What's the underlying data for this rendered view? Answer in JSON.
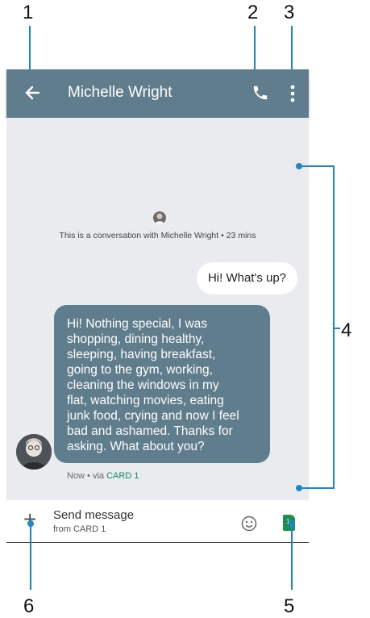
{
  "callouts": {
    "n1": "1",
    "n2": "2",
    "n3": "3",
    "n4": "4",
    "n5": "5",
    "n6": "6"
  },
  "appbar": {
    "title": "Michelle Wright",
    "back_icon": "arrow-back-icon",
    "phone_icon": "phone-icon",
    "menu_icon": "more-vert-icon"
  },
  "conversation": {
    "intro_text": "This is a conversation with Michelle Wright • 23 mins",
    "outgoing_message": "Hi! What's up?",
    "incoming_lines": [
      "Hi! Nothing special, I was",
      "shopping, dining healthy,",
      "sleeping,  having breakfast,",
      "going to the gym, working,",
      "cleaning the windows in my",
      "flat, watching movies, eating",
      "junk food, crying and now I feel",
      "bad and ashamed. Thanks for",
      "asking. What about you?"
    ],
    "meta_time": "Now • via ",
    "meta_sim": "CARD 1"
  },
  "composer": {
    "plus_label": "+",
    "placeholder": "Send message",
    "sim_sub": "from CARD 1",
    "emoji_icon": "emoji-icon",
    "sim_icon": "sim-card-icon",
    "sim_number": "1"
  },
  "colors": {
    "appbar": "#5f7d8c",
    "incoming_bubble": "#5f7d8c",
    "conversation_bg": "#e9ebee",
    "callout_line": "#1e88c7",
    "sim_icon": "#1f8e50"
  }
}
